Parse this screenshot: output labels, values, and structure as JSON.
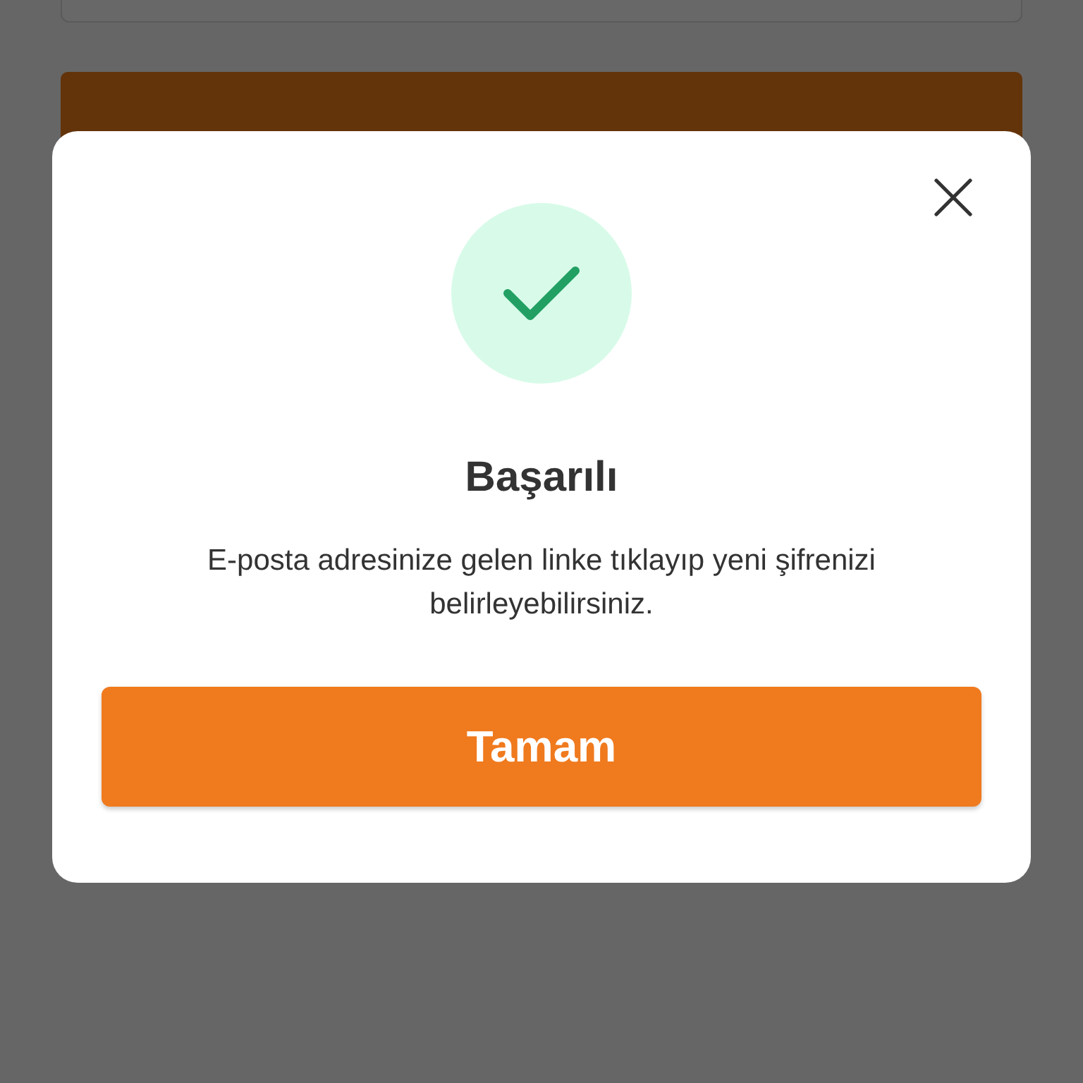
{
  "dialog": {
    "title": "Başarılı",
    "message": "E-posta adresinize gelen linke tıklayıp yeni şifrenizi belirleyebilirsiniz.",
    "confirm_button": "Tamam"
  }
}
